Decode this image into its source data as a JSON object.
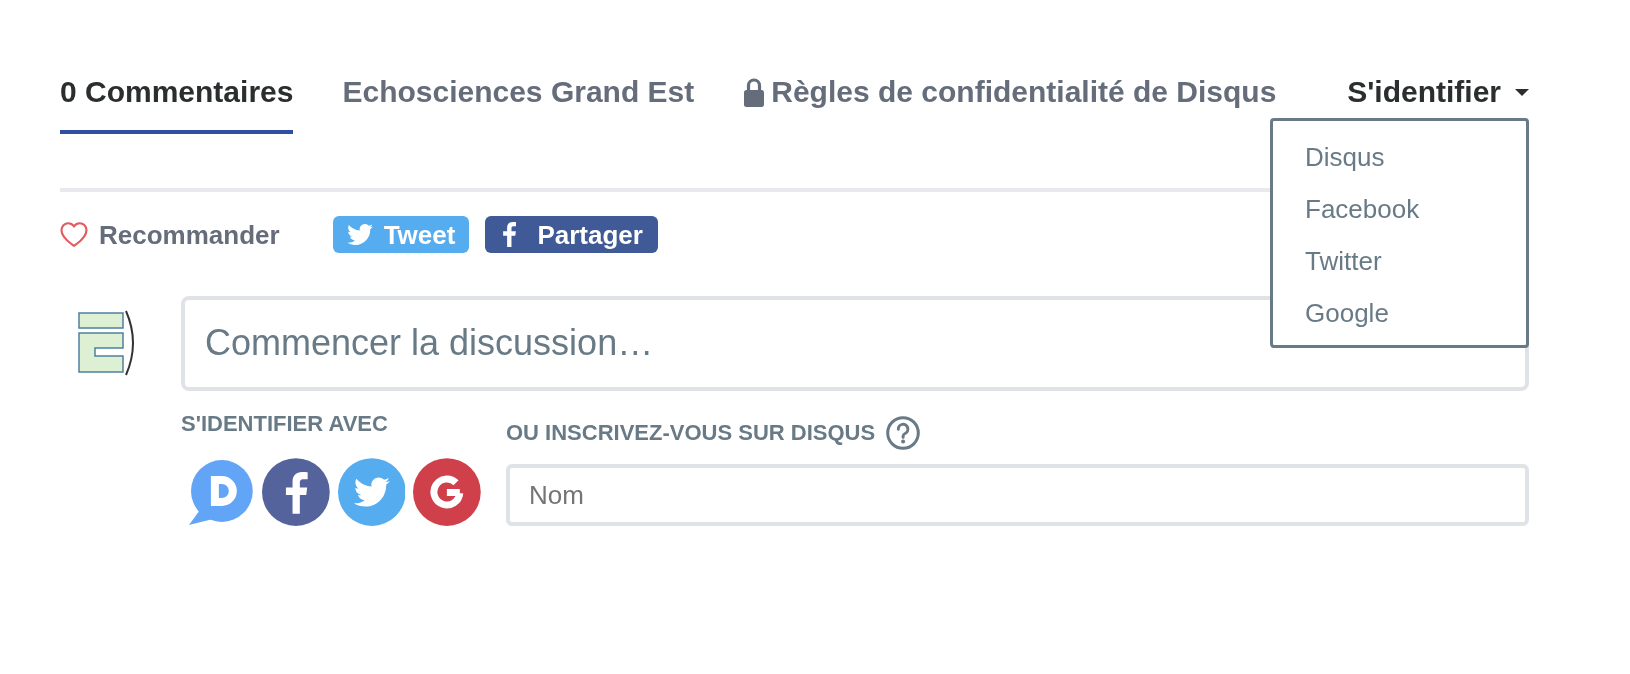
{
  "tabs": [
    {
      "label": "0 Commentaires",
      "kind": "count",
      "selected": true
    },
    {
      "label": "Echosciences Grand Est",
      "kind": "forum",
      "selected": false
    },
    {
      "label": "Règles de confidentialité de Disqus",
      "kind": "privacy",
      "selected": false
    }
  ],
  "login": {
    "label": "S'identifier",
    "expanded": true,
    "options": [
      "Disqus",
      "Facebook",
      "Twitter",
      "Google"
    ]
  },
  "actions": {
    "recommend": {
      "label": "Recommander",
      "on": false
    },
    "share": [
      {
        "label": "Tweet",
        "kind": "twitter"
      },
      {
        "label": "Partager",
        "kind": "facebook"
      }
    ]
  },
  "composer": {
    "placeholder": "Commencer la discussion…"
  },
  "login_with": {
    "label": "S'IDENTIFIER AVEC"
  },
  "signup": {
    "label": "OU INSCRIVEZ-VOUS SUR DISQUS",
    "name_field": {
      "placeholder": "Nom"
    }
  }
}
